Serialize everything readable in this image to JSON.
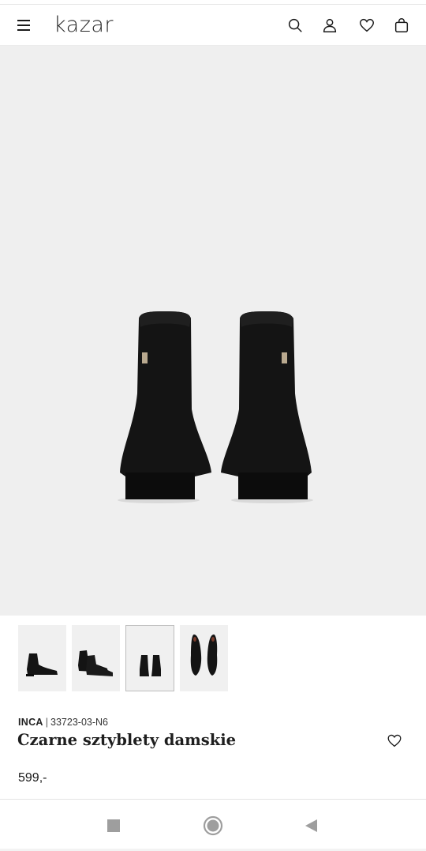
{
  "header": {
    "logo": "kazar"
  },
  "gallery": {
    "thumbnails": [
      "side view",
      "pair angled view",
      "back view",
      "top view"
    ],
    "selected_index": 2
  },
  "product": {
    "brand": "INCA",
    "separator": "|",
    "sku": "33723-03-N6",
    "title": "Czarne sztyblety damskie",
    "price": "599,-"
  },
  "icons": {
    "menu": "hamburger-menu-icon",
    "search": "search-icon",
    "account": "user-icon",
    "wishlist": "heart-icon",
    "cart": "shopping-bag-icon",
    "nav_recent": "square-icon",
    "nav_home": "circle-icon",
    "nav_back": "triangle-back-icon"
  },
  "colors": {
    "hero_bg": "#efefef",
    "text": "#1a1a1a",
    "nav_icon": "#9e9e9e"
  }
}
